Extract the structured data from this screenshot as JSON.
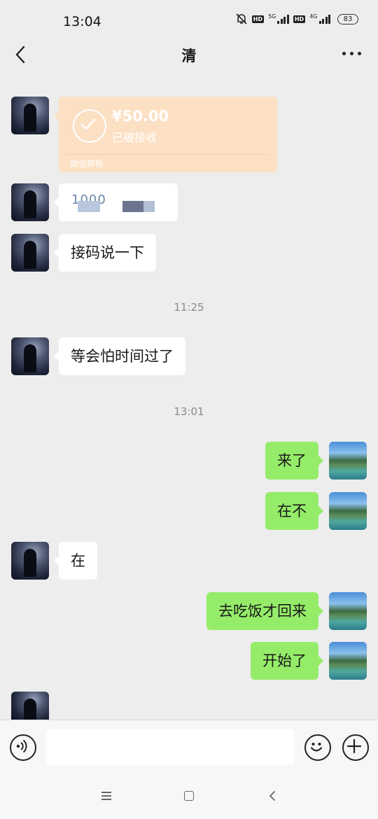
{
  "status_bar": {
    "time": "13:04",
    "net1": "5G",
    "net2": "4G",
    "battery": "83"
  },
  "header": {
    "title": "清"
  },
  "messages": {
    "transfer": {
      "amount": "¥50.00",
      "status": "已被接收",
      "label": "微信转账"
    },
    "m2_partial": "1000",
    "m3": "接码说一下",
    "ts1": "11:25",
    "m4": "等会怕时间过了",
    "ts2": "13:01",
    "m5": "来了",
    "m6": "在不",
    "m7": "在",
    "m8": "去吃饭才回来",
    "m9": "开始了"
  },
  "input_bar": {
    "value": "",
    "placeholder": ""
  },
  "icons": {
    "back": "chevron-left-icon",
    "more": "more-icon",
    "voice": "voice-icon",
    "emoji": "emoji-icon",
    "plus": "plus-icon",
    "check": "check-icon"
  },
  "colors": {
    "background": "#ededed",
    "green_bubble": "#95ec69",
    "white_bubble": "#ffffff",
    "transfer_card": "#fce0c4"
  }
}
